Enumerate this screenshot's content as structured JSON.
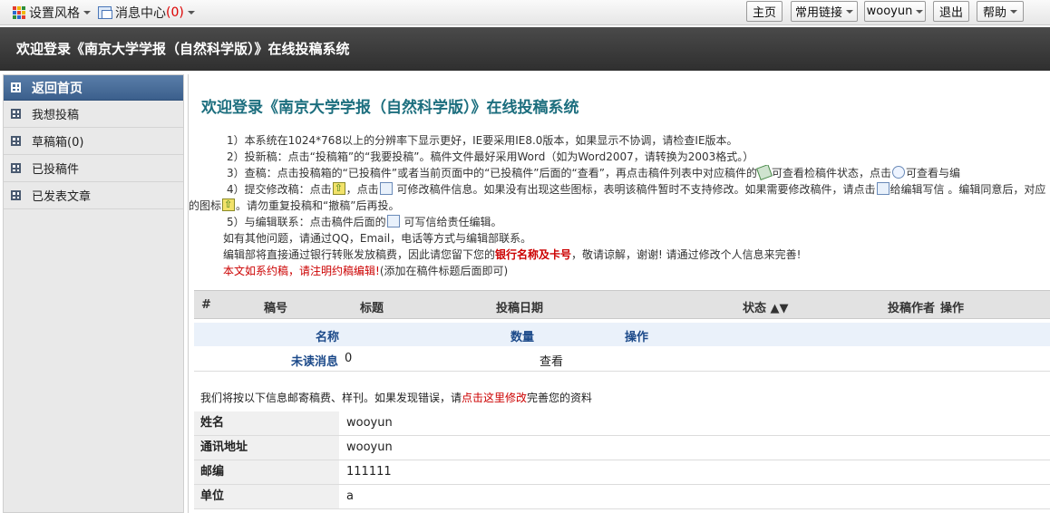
{
  "topbar": {
    "style_menu": "设置风格",
    "message_center": "消息中心",
    "message_count": "(0)",
    "buttons": {
      "home": "主页",
      "links": "常用链接",
      "user": "wooyun",
      "logout": "退出",
      "help": "帮助"
    }
  },
  "header": {
    "title": "欢迎登录《南京大学学报（自然科学版）》在线投稿系统"
  },
  "sidebar": {
    "head": "返回首页",
    "items": [
      {
        "label": "我想投稿"
      },
      {
        "label": "草稿箱(0)"
      },
      {
        "label": "已投稿件"
      },
      {
        "label": "已发表文章"
      }
    ]
  },
  "main": {
    "title": "欢迎登录《南京大学学报（自然科学版）》在线投稿系统",
    "notice": {
      "l1": "1）本系统在1024*768以上的分辨率下显示更好，IE要采用IE8.0版本，如果显示不协调，请检查IE版本。",
      "l2": "2）投新稿：点击“投稿箱”的“我要投稿”。稿件文件最好采用Word（如为Word2007，请转换为2003格式。）",
      "l3a": "3）查稿：点击投稿箱的“已投稿件”或者当前页面中的“已投稿件”后面的“查看”，再点击稿件列表中对应稿件的",
      "l3b": "可查看检稿件状态，点击",
      "l3c": "可查看与编",
      "l4a": "4）提交修改稿：点击",
      "l4b": "，点击",
      "l4c": "可修改稿件信息。如果没有出现这些图标，表明该稿件暂时不支持修改。如果需要修改稿件，请点击",
      "l4d": "给编辑写信 。编辑同意后，对应",
      "l4e": "的图标",
      "l4f": "。请勿重复投稿和“撤稿”后再投。",
      "l5a": "5）与编辑联系：点击稿件后面的",
      "l5b": "可写信给责任编辑。",
      "l6": "如有其他问题，请通过QQ，Email，电话等方式与编辑部联系。",
      "l7a": "编辑部将直接通过银行转账发放稿费，因此请您留下您的",
      "l7b": "银行名称及卡号",
      "l7c": "，敬请谅解，谢谢!    请通过修改个人信息来完善!",
      "l8a": "本文如系约稿，请注明约稿编辑!",
      "l8b": "(添加在稿件标题后面即可)"
    },
    "manuscripts_table": {
      "headers": [
        "#",
        "稿号",
        "标题",
        "投稿日期",
        "状态 ▲▼",
        "投稿作者",
        "操作"
      ]
    },
    "messages": {
      "headers": [
        "名称",
        "数量",
        "操作"
      ],
      "rows": [
        {
          "name": "未读消息",
          "count": "0",
          "action": "查看"
        }
      ]
    },
    "address_note": {
      "prefix": "我们将按以下信息邮寄稿费、样刊。如果发现错误，请",
      "link": "点击这里修改",
      "suffix": "完善您的资料"
    },
    "profile": [
      {
        "key": "姓名",
        "value": "wooyun"
      },
      {
        "key": "通讯地址",
        "value": "wooyun"
      },
      {
        "key": "邮编",
        "value": "111111"
      },
      {
        "key": "单位",
        "value": "a"
      }
    ]
  }
}
